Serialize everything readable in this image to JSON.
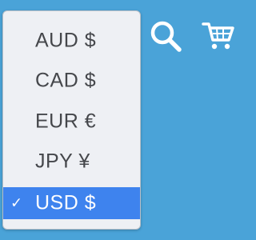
{
  "currency_menu": {
    "options": [
      {
        "label": "AUD $",
        "selected": false
      },
      {
        "label": "CAD $",
        "selected": false
      },
      {
        "label": "EUR €",
        "selected": false
      },
      {
        "label": "JPY ¥",
        "selected": false
      },
      {
        "label": "USD $",
        "selected": true
      }
    ],
    "checkmark": "✓"
  },
  "header": {
    "icons": [
      "search-icon",
      "shopping-cart-icon"
    ]
  },
  "colors": {
    "background": "#4aa3d8",
    "menu_background": "#eef0f4",
    "menu_text": "#45474b",
    "selected_background": "#3e83ee",
    "selected_text": "#ffffff",
    "icon_color": "#ffffff"
  }
}
